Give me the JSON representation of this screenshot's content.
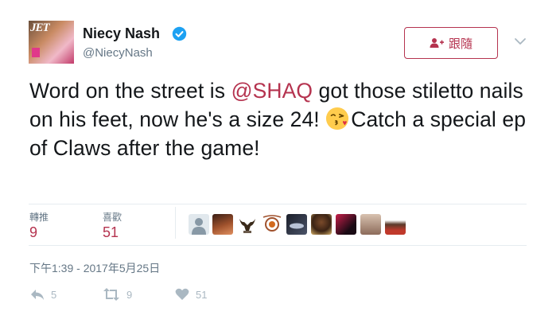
{
  "user": {
    "display_name": "Niecy Nash",
    "handle": "@NiecyNash",
    "avatar_magazine_text": "JET"
  },
  "follow_button": {
    "label": "跟隨",
    "icon": "add-person-icon"
  },
  "tweet": {
    "text_part1": "Word on the street is ",
    "mention": "@SHAQ",
    "text_part2": " got those stiletto nails on his feet, now he's a size 24! ",
    "emoji": "face-blowing-kiss",
    "text_part3": "Catch a special ep of Claws after the game!"
  },
  "stats": {
    "retweets_label": "轉推",
    "retweets_count": "9",
    "likes_label": "喜歡",
    "likes_count": "51"
  },
  "likers": [
    {
      "name": "default-avatar"
    },
    {
      "name": "liker-2"
    },
    {
      "name": "liker-3-bull-logo"
    },
    {
      "name": "liker-4-logo"
    },
    {
      "name": "liker-5"
    },
    {
      "name": "liker-6"
    },
    {
      "name": "liker-7"
    },
    {
      "name": "liker-8"
    },
    {
      "name": "liker-9"
    }
  ],
  "timestamp": "下午1:39 - 2017年5月25日",
  "actions": {
    "reply_count": "5",
    "retweet_count": "9",
    "like_count": "51"
  },
  "colors": {
    "accent": "#b5334f",
    "text": "#14171a",
    "secondary": "#657786",
    "verified": "#1da1f2"
  }
}
